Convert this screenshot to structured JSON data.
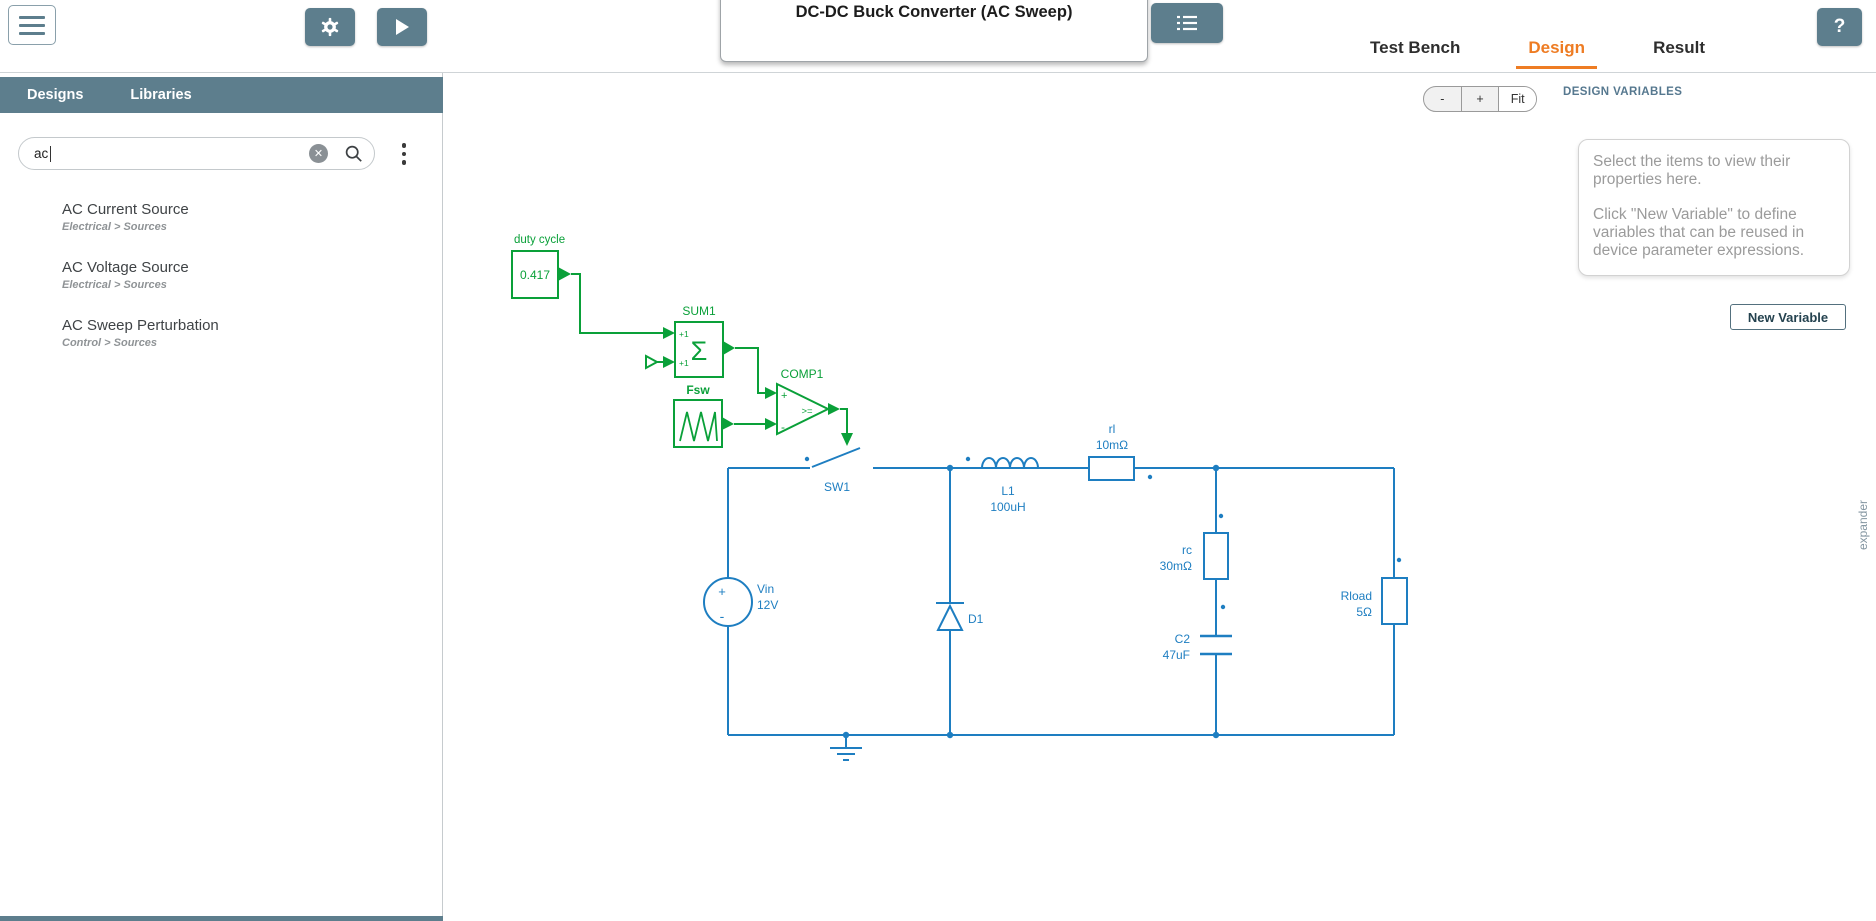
{
  "app": {
    "title": "DC-DC Buck Converter (AC Sweep)",
    "tabs": {
      "test_bench": "Test Bench",
      "design": "Design",
      "result": "Result"
    },
    "help_label": "?"
  },
  "sidebar": {
    "tabs": {
      "designs": "Designs",
      "libraries": "Libraries"
    },
    "search": {
      "value": "ac"
    },
    "results": [
      {
        "name": "AC Current Source",
        "path": "Electrical > Sources"
      },
      {
        "name": "AC Voltage Source",
        "path": "Electrical > Sources"
      },
      {
        "name": "AC Sweep Perturbation",
        "path": "Control > Sources"
      }
    ]
  },
  "canvas": {
    "zoom": {
      "out": "-",
      "in": "+",
      "fit": "Fit"
    },
    "design_variables": {
      "heading": "DESIGN VARIABLES",
      "info_line1": "Select the items to view their properties here.",
      "info_line2": "Click \"New Variable\" to define variables that can be reused in device parameter expressions.",
      "new_variable_label": "New Variable"
    },
    "edge_label": "expander"
  },
  "schematic": {
    "duty_cycle": {
      "label": "duty cycle",
      "value": "0.417"
    },
    "sum": {
      "label": "SUM1",
      "sigma": "Σ",
      "in1": "+1",
      "in2": "+1"
    },
    "comp": {
      "label": "COMP1",
      "op": ">=",
      "plus": "+",
      "minus": "-"
    },
    "fsw": {
      "label": "Fsw"
    },
    "sw": {
      "label": "SW1"
    },
    "vin": {
      "label": "Vin",
      "value": "12V",
      "plus": "+",
      "minus": "-"
    },
    "d1": {
      "label": "D1"
    },
    "l1": {
      "label": "L1",
      "value": "100uH"
    },
    "rl": {
      "label": "rl",
      "value": "10mΩ"
    },
    "rc": {
      "label": "rc",
      "value": "30mΩ"
    },
    "c2": {
      "label": "C2",
      "value": "47uF"
    },
    "rload": {
      "label": "Rload",
      "value": "5Ω"
    }
  },
  "colors": {
    "control_green": "#0aa039",
    "power_blue": "#1e7ec1",
    "accent_orange": "#ee7c23",
    "slate": "#5d7e8d"
  }
}
